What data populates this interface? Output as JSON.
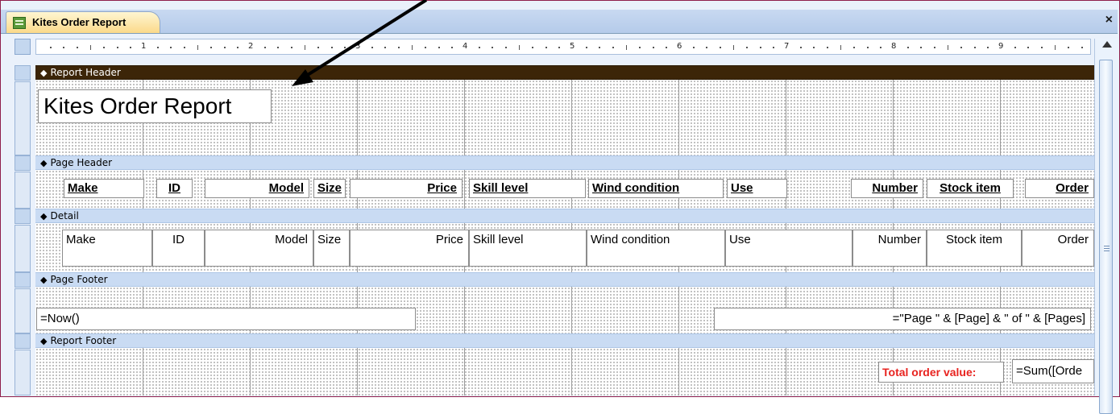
{
  "window": {
    "tab_title": "Kites Order Report",
    "tab_icon": "report-icon",
    "close_glyph": "×"
  },
  "ruler": {
    "numbers": [
      "1",
      "2",
      "3",
      "4",
      "5",
      "6",
      "7",
      "8",
      "9"
    ]
  },
  "sections": {
    "report_header": "Report Header",
    "page_header": "Page Header",
    "detail": "Detail",
    "page_footer": "Page Footer",
    "report_footer": "Report Footer"
  },
  "report_title": "Kites Order Report",
  "page_header_labels": {
    "make": "Make",
    "id": "ID",
    "model": "Model",
    "size": "Size",
    "price": "Price",
    "skill": "Skill level",
    "wind": "Wind condition",
    "use": "Use",
    "number": "Number",
    "stock": "Stock item",
    "order": "Order"
  },
  "detail_fields": {
    "make": "Make",
    "id": "ID",
    "model": "Model",
    "size": "Size",
    "price": "Price",
    "skill": "Skill level",
    "wind": "Wind condition",
    "use": "Use",
    "number": "Number",
    "stock": "Stock item",
    "order": "Order"
  },
  "page_footer": {
    "date_expr": "=Now()",
    "page_expr": "=\"Page \" & [Page] & \" of \" & [Pages]"
  },
  "report_footer": {
    "total_label": "Total order value:",
    "total_expr": "=Sum([Orde"
  },
  "colors": {
    "selected_band": "#3c2508",
    "band": "#c9dbf3",
    "total_label": "#e8231f",
    "frame": "#8e1e4b"
  }
}
